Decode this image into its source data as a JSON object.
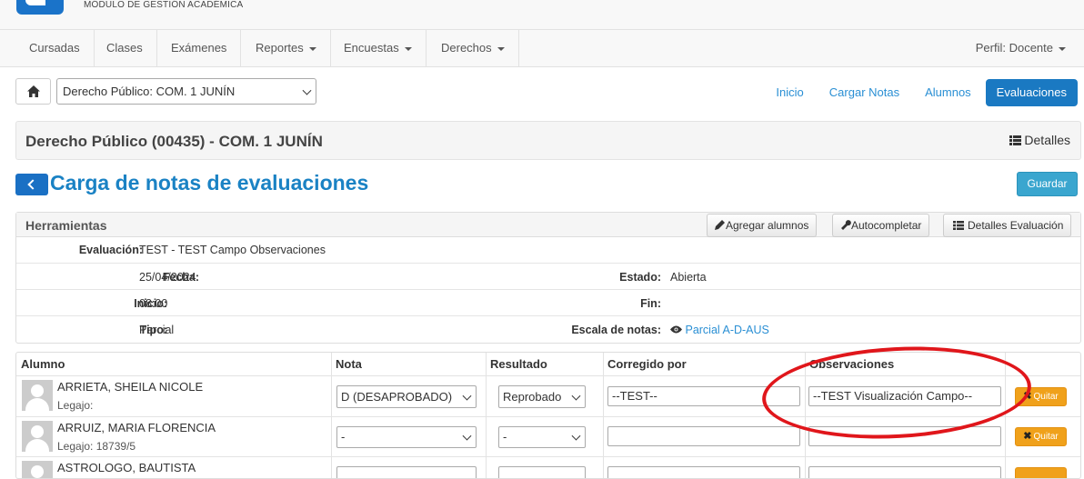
{
  "brand": {
    "subtitle": "MÓDULO DE GESTIÓN ACADÉMICA"
  },
  "nav": {
    "items": [
      {
        "label": "Cursadas",
        "dropdown": false
      },
      {
        "label": "Clases",
        "dropdown": false
      },
      {
        "label": "Exámenes",
        "dropdown": false
      },
      {
        "label": "Reportes",
        "dropdown": true
      },
      {
        "label": "Encuestas",
        "dropdown": true
      },
      {
        "label": "Derechos",
        "dropdown": true
      }
    ],
    "perfil": "Perfil: Docente"
  },
  "toolbar": {
    "course_select": "Derecho Público: COM. 1 JUNÍN",
    "tabs": [
      {
        "label": "Inicio",
        "active": false
      },
      {
        "label": "Cargar Notas",
        "active": false
      },
      {
        "label": "Alumnos",
        "active": false
      },
      {
        "label": "Evaluaciones",
        "active": true
      }
    ]
  },
  "subject": {
    "title": "Derecho Público (00435) - COM. 1 JUNÍN",
    "details_label": "Detalles"
  },
  "page": {
    "title": "Carga de notas de evaluaciones",
    "save_label": "Guardar"
  },
  "tools": {
    "title": "Herramientas",
    "buttons": {
      "add_students": "Agregar alumnos",
      "autocomplete": "Autocompletar",
      "eval_details": "Detalles Evaluación"
    },
    "fields": {
      "evaluacion_label": "Evaluación:",
      "evaluacion_value": "TEST - TEST Campo Observaciones",
      "fecha_label": "Fecha:",
      "fecha_value": "25/04/2024",
      "estado_label": "Estado:",
      "estado_value": "Abierta",
      "inicio_label": "Inicio:",
      "inicio_value": "08:00",
      "fin_label": "Fin:",
      "fin_value": "",
      "tipo_label": "Tipo:",
      "tipo_value": "Parcial",
      "escala_label": "Escala de notas:",
      "escala_value": "Parcial A-D-AUS"
    }
  },
  "table": {
    "headers": {
      "alumno": "Alumno",
      "nota": "Nota",
      "resultado": "Resultado",
      "corregido": "Corregido por",
      "observaciones": "Observaciones"
    },
    "rows": [
      {
        "name": "ARRIETA, SHEILA NICOLE",
        "legajo": "Legajo:",
        "nota": "D (DESAPROBADO)",
        "resultado": "Reprobado",
        "corregido": "--TEST--",
        "observaciones": "--TEST Visualización Campo--",
        "quitar": "Quitar"
      },
      {
        "name": "ARRUIZ, MARIA FLORENCIA",
        "legajo": "Legajo:  18739/5",
        "nota": "-",
        "resultado": "-",
        "corregido": "",
        "observaciones": "",
        "quitar": "Quitar"
      },
      {
        "name": "ASTROLOGO, BAUTISTA",
        "legajo": "",
        "nota": "",
        "resultado": "",
        "corregido": "",
        "observaciones": "",
        "quitar": ""
      }
    ]
  },
  "colors": {
    "primary": "#1a79c2",
    "link": "#2a8fd4",
    "save": "#3aa6cf",
    "quitar": "#f0a11b",
    "annotation": "#e0161b"
  }
}
